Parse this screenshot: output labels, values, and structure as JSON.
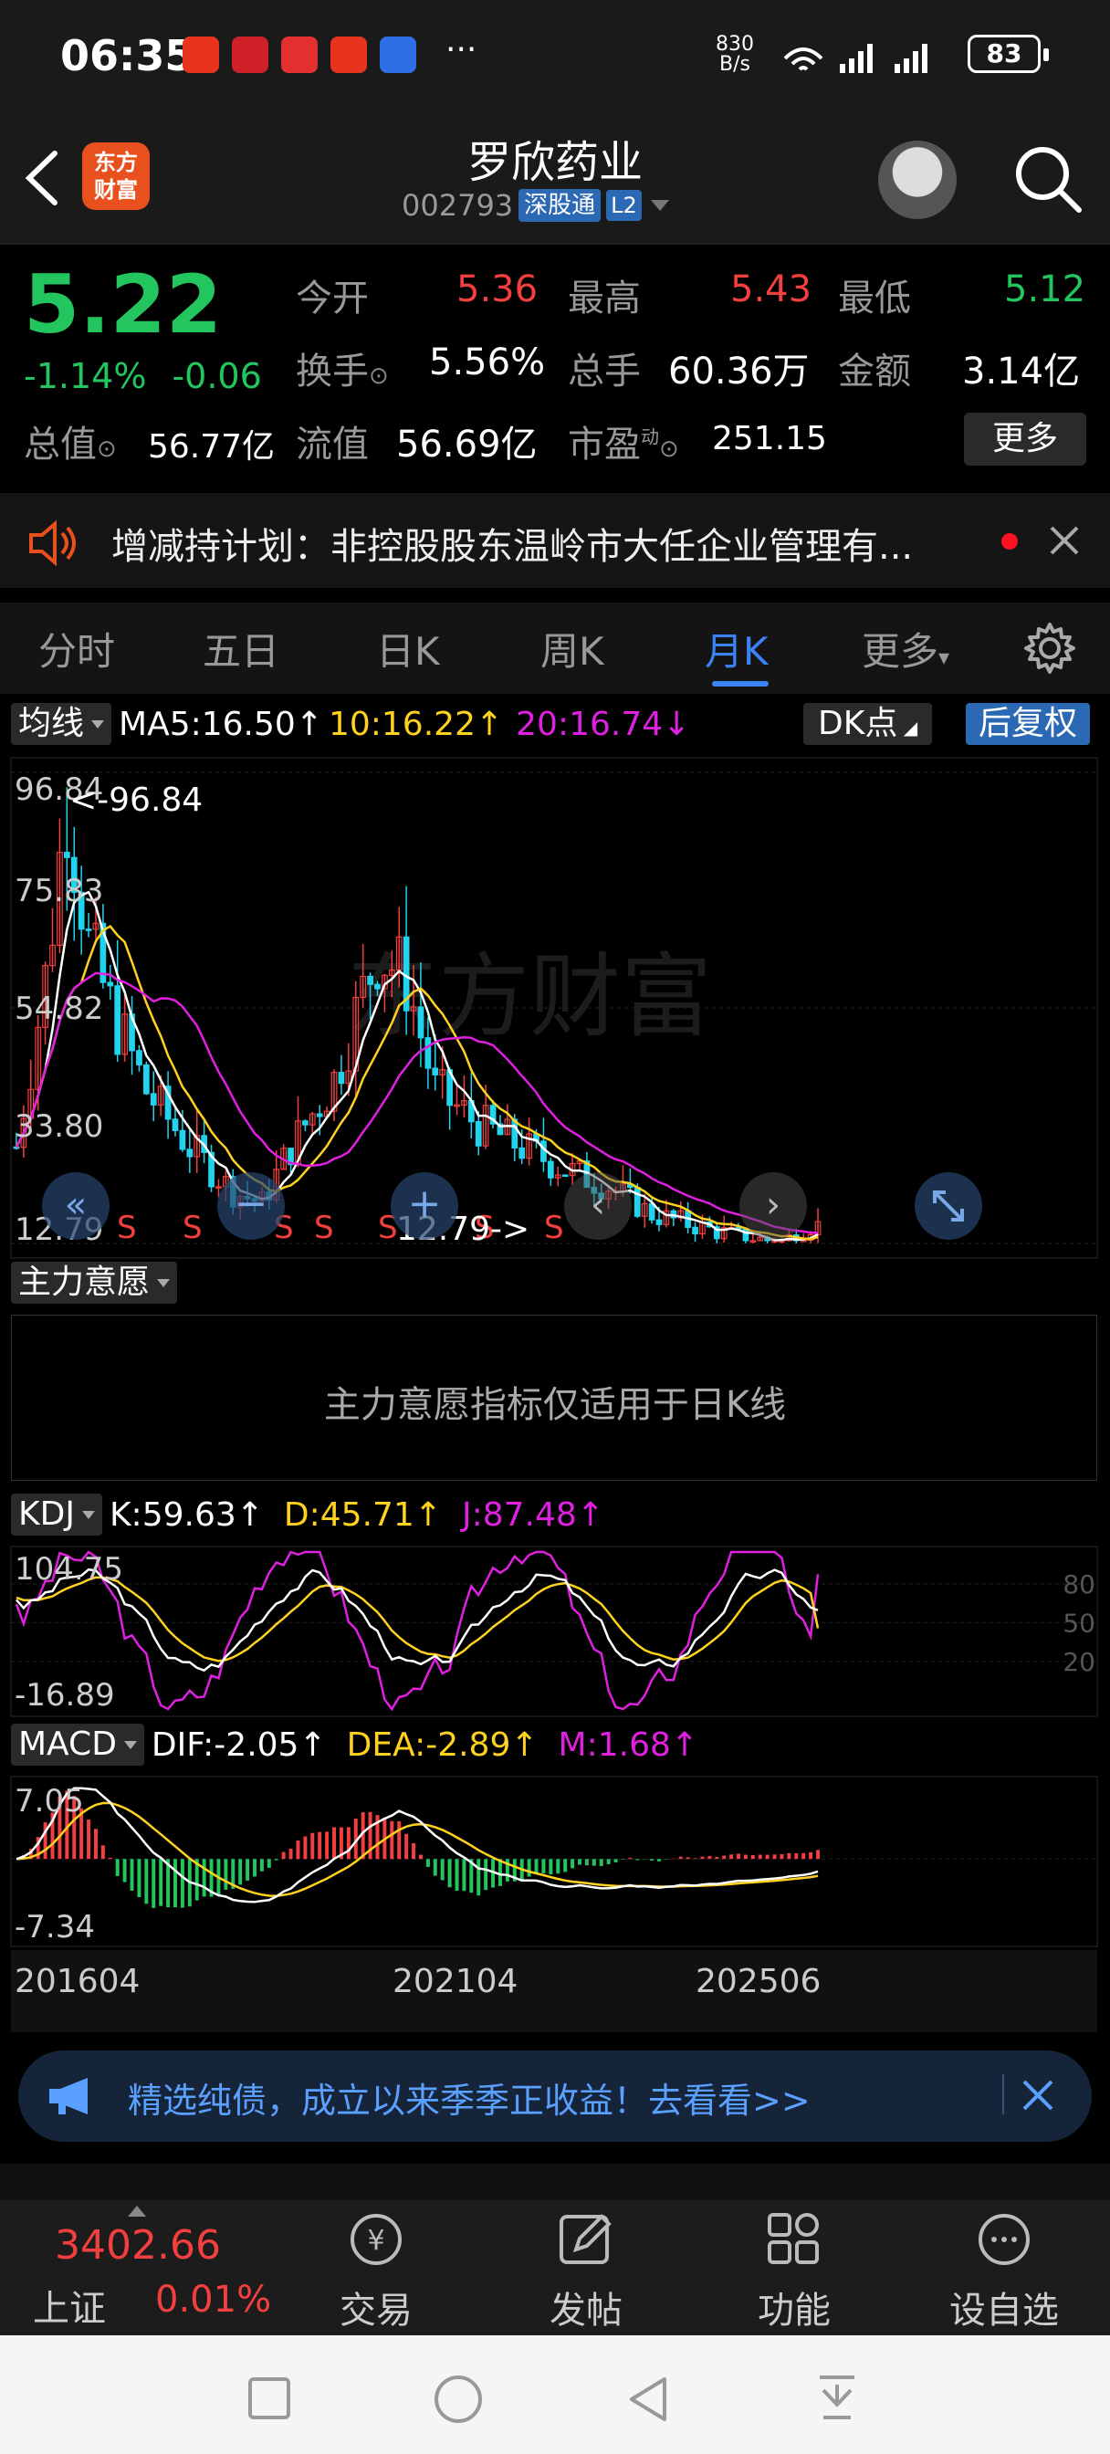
{
  "status_bar": {
    "time": "06:35",
    "net_speed_top": "830",
    "net_speed_bottom": "B/s",
    "battery": "83"
  },
  "header": {
    "logo_line1": "东方",
    "logo_line2": "财富",
    "stock_name": "罗欣药业",
    "stock_code": "002793",
    "tag_sgt": "深股通",
    "tag_l2": "L2"
  },
  "quote": {
    "price": "5.22",
    "change_pct": "-1.14%",
    "change_abs": "-0.06",
    "open_label": "今开",
    "open": "5.36",
    "high_label": "最高",
    "high": "5.43",
    "low_label": "最低",
    "low": "5.12",
    "turnover_label": "换手",
    "turnover": "5.56%",
    "volume_label": "总手",
    "volume": "60.36万",
    "amount_label": "金额",
    "amount": "3.14亿",
    "total_mv_label": "总值",
    "total_mv": "56.77亿",
    "float_mv_label": "流值",
    "float_mv": "56.69亿",
    "pe_label": "市盈",
    "pe_sup": "动",
    "pe": "251.15",
    "more_label": "更多"
  },
  "notice": {
    "text": "增减持计划：非控股股东温岭市大任企业管理有..."
  },
  "tabs": [
    "分时",
    "五日",
    "日K",
    "周K",
    "月K",
    "更多"
  ],
  "active_tab": "月K",
  "chart": {
    "ma_dropdown": "均线",
    "ma5": "MA5:16.50↑",
    "ma10": "10:16.22↑",
    "ma20": "20:16.74↓",
    "dk_label": "DK点",
    "restore_label": "后复权",
    "price_ticks": [
      "96.84",
      "75.83",
      "54.82",
      "33.80",
      "12.79"
    ],
    "max_marker": "<-96.84",
    "min_marker": "12.79->",
    "zhuli_dropdown": "主力意愿",
    "zhuli_msg": "主力意愿指标仅适用于日K线",
    "kdj_dropdown": "KDJ",
    "kdj_k": "K:59.63↑",
    "kdj_d": "D:45.71↑",
    "kdj_j": "J:87.48↑",
    "kdj_ticks": [
      "104.75",
      "-16.89"
    ],
    "kdj_levels": [
      "80",
      "50",
      "20"
    ],
    "macd_dropdown": "MACD",
    "macd_dif": "DIF:-2.05↑",
    "macd_dea": "DEA:-2.89↑",
    "macd_m": "M:1.68↑",
    "macd_ticks": [
      "7.05",
      "-7.34"
    ],
    "date_labels": [
      "201604",
      "202104",
      "202506"
    ]
  },
  "chart_data": {
    "type": "candlestick",
    "title": "罗欣药业 月K",
    "y_range": [
      12.79,
      96.84
    ],
    "x_start": "201604",
    "x_end": "202506",
    "max_price": 96.84,
    "min_price": 12.79,
    "ma": {
      "ma5": 16.5,
      "ma10": 16.22,
      "ma20": 16.74
    },
    "kdj": {
      "K": 59.63,
      "D": 45.71,
      "J": 87.48,
      "range": [
        -16.89,
        104.75
      ]
    },
    "macd": {
      "DIF": -2.05,
      "DEA": -2.89,
      "M": 1.68,
      "range": [
        -7.34,
        7.05
      ]
    }
  },
  "ad": {
    "text": "精选纯债，成立以来季季正收益！去看看>>"
  },
  "bottom": {
    "index_value": "3402.66",
    "index_name": "上证",
    "index_pct": "0.01%",
    "items": [
      "交易",
      "发帖",
      "功能",
      "设自选"
    ]
  },
  "colors": {
    "up": "#f43f3f",
    "down": "#22c55e",
    "accent": "#3b82f6",
    "ma5": "#ffffff",
    "ma10": "#ffd21f",
    "ma20": "#e020e0"
  }
}
